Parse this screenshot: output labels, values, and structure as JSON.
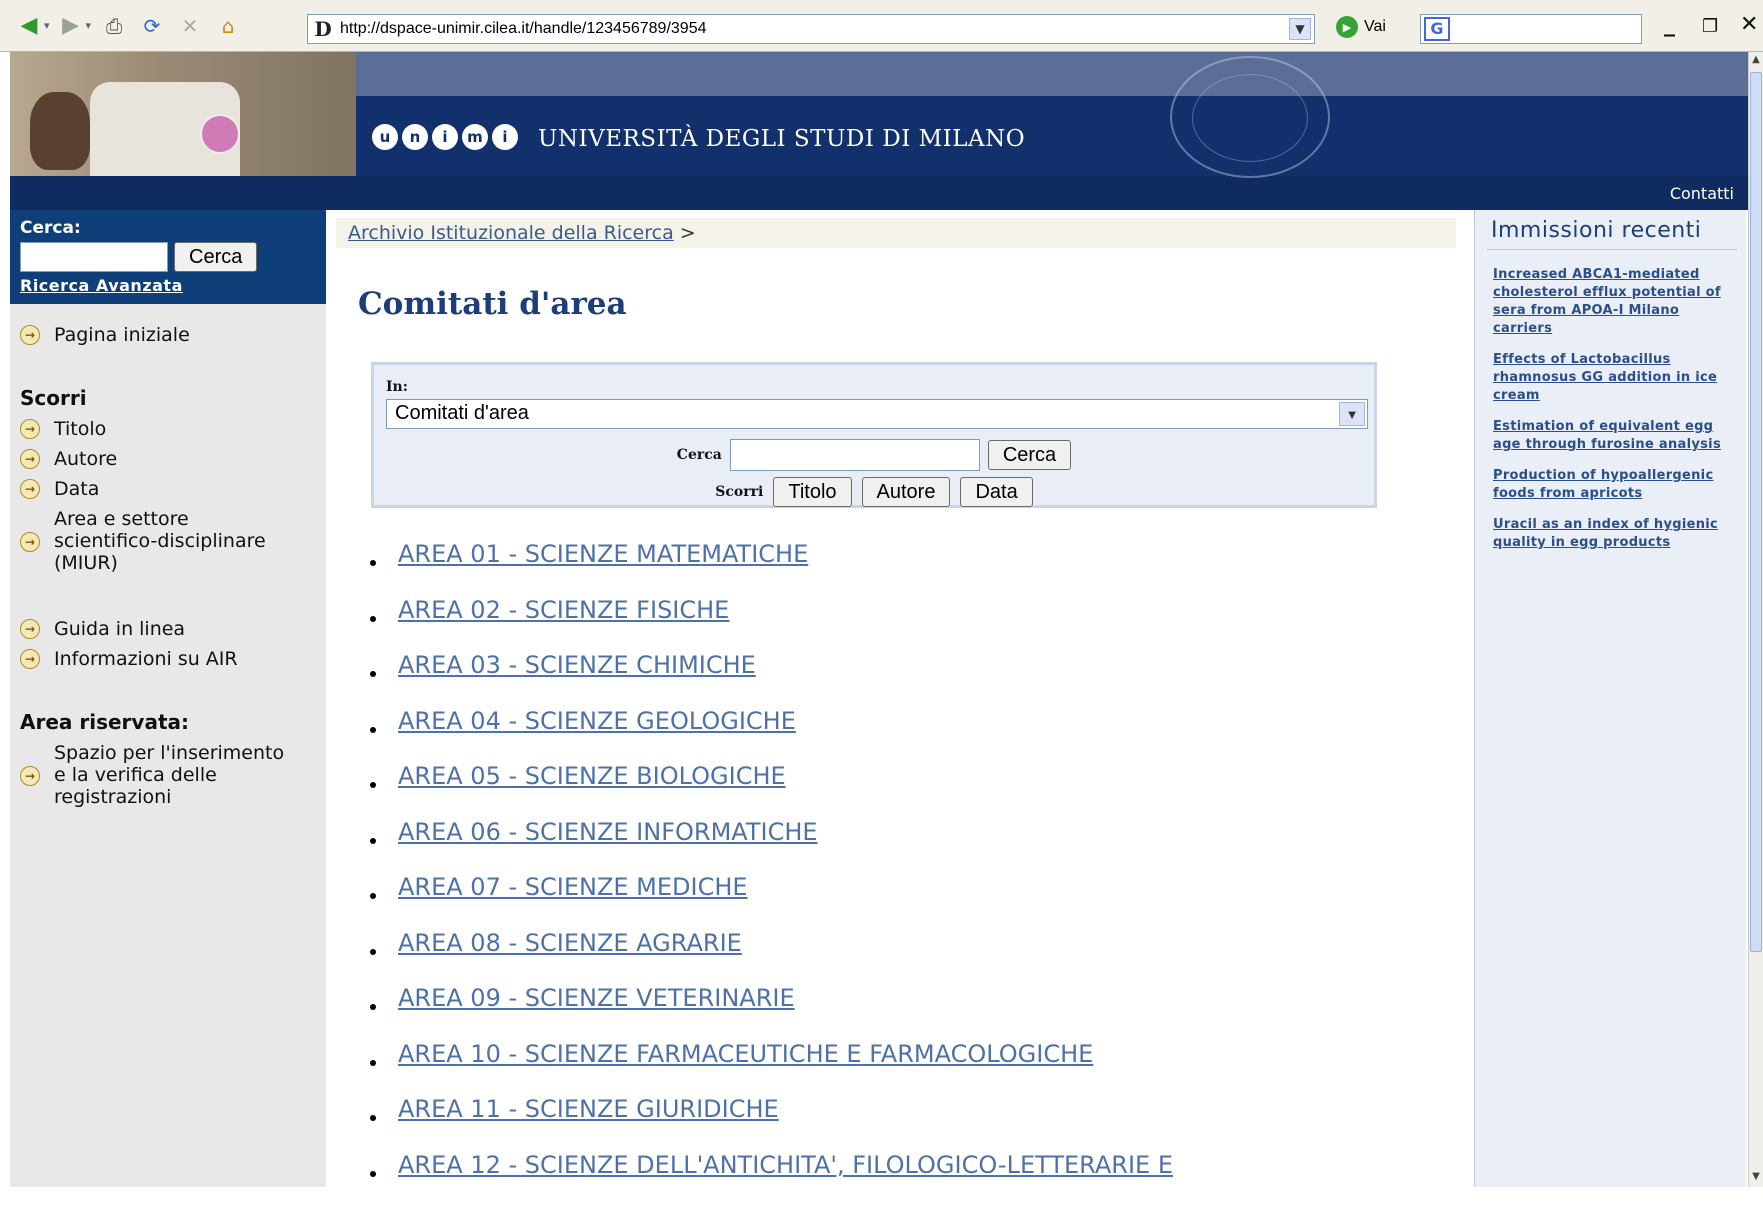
{
  "browser": {
    "url": "http://dspace-unimir.cilea.it/handle/123456789/3954",
    "go_label": "Vai",
    "favicon": "D",
    "search_logo": "G"
  },
  "header": {
    "logo_letters": [
      "u",
      "n",
      "i",
      "m",
      "i"
    ],
    "university": "UNIVERSITÀ DEGLI STUDI DI MILANO",
    "contacts": "Contatti"
  },
  "sidebar": {
    "search_label": "Cerca:",
    "search_button": "Cerca",
    "advanced_link": "Ricerca Avanzata",
    "home": "Pagina iniziale",
    "browse_heading": "Scorri",
    "browse_items": [
      "Titolo",
      "Autore",
      "Data"
    ],
    "area_line1": "Area e settore",
    "area_line2": "scientifico-disciplinare",
    "area_line3": "(MIUR)",
    "help": "Guida in linea",
    "info": "Informazioni su AIR",
    "reserved_heading": "Area riservata:",
    "reserved_line1": "Spazio per l'inserimento",
    "reserved_line2": "e la verifica delle",
    "reserved_line3": "registrazioni"
  },
  "main": {
    "breadcrumb_link": "Archivio Istituzionale della Ricerca",
    "breadcrumb_sep": ">",
    "title": "Comitati d'area",
    "scope_label": "In:",
    "scope_value": "Comitati d'area",
    "search_label": "Cerca",
    "search_button": "Cerca",
    "browse_label": "Scorri",
    "browse_title": "Titolo",
    "browse_author": "Autore",
    "browse_date": "Data",
    "areas": [
      "AREA 01 - SCIENZE MATEMATICHE",
      "AREA 02 - SCIENZE FISICHE",
      "AREA 03 - SCIENZE CHIMICHE",
      "AREA 04 - SCIENZE GEOLOGICHE",
      "AREA 05 - SCIENZE BIOLOGICHE",
      "AREA 06 - SCIENZE INFORMATICHE",
      "AREA 07 - SCIENZE MEDICHE",
      "AREA 08 - SCIENZE AGRARIE",
      "AREA 09 - SCIENZE VETERINARIE",
      "AREA 10 - SCIENZE FARMACEUTICHE E FARMACOLOGICHE",
      "AREA 11 - SCIENZE GIURIDICHE",
      "AREA 12 - SCIENZE DELL'ANTICHITA', FILOLOGICO-LETTERARIE E"
    ]
  },
  "recent": {
    "heading": "Immissioni recenti",
    "items": [
      "Increased ABCA1-mediated cholesterol efflux potential of sera from APOA-I Milano carriers",
      "Effects of Lactobacillus rhamnosus GG addition in ice cream",
      "Estimation of equivalent egg age through furosine analysis",
      "Production of hypoallergenic foods from apricots",
      "Uracil as an index of hygienic quality in egg products"
    ]
  },
  "colors": {
    "header_band": "#12306b",
    "sidebar_search": "#0f3f78",
    "title": "#1d3e78",
    "area_link": "#4d71a8"
  },
  "icons": [
    "back-arrow-icon",
    "forward-arrow-icon",
    "print-icon",
    "refresh-icon",
    "stop-icon",
    "home-icon",
    "go-icon",
    "circle-arrow-icon",
    "dropdown-arrow-icon",
    "minimize-icon",
    "maximize-icon",
    "close-icon"
  ]
}
